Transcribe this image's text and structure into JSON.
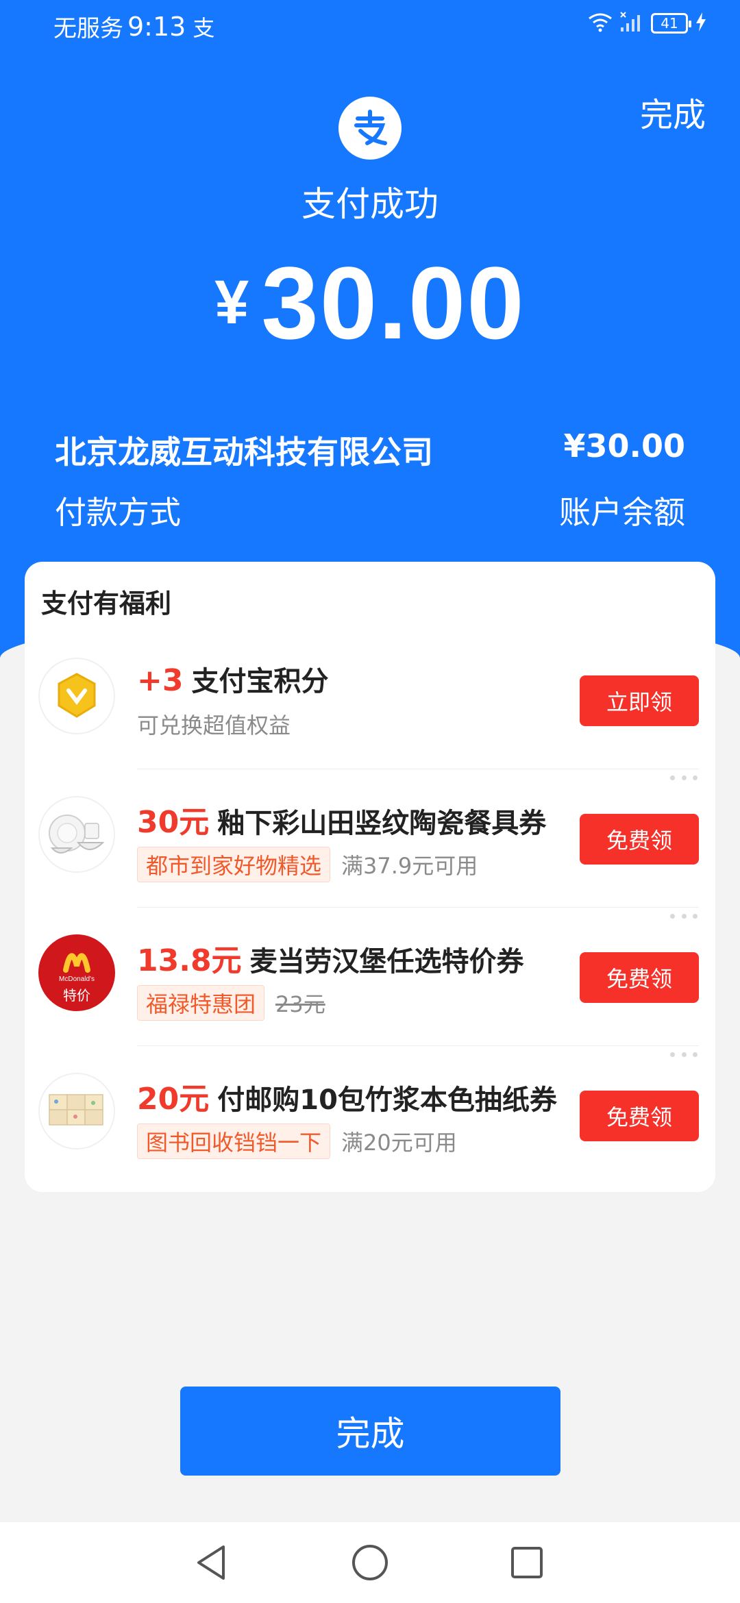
{
  "status_bar": {
    "carrier": "无服务",
    "time": "9:13",
    "alipay_glyph": "支",
    "battery": "41"
  },
  "header": {
    "done_label": "完成",
    "success_text": "支付成功",
    "currency_symbol": "¥",
    "amount": "30.00"
  },
  "details": {
    "merchant": "北京龙威互动科技有限公司",
    "merchant_amount": "¥30.00",
    "payment_method_label": "付款方式",
    "payment_method_value": "账户余额"
  },
  "benefits": {
    "title": "支付有福利",
    "items": [
      {
        "highlight": "+3",
        "title": "支付宝积分",
        "subtitle": "可兑换超值权益",
        "tag": "",
        "note": "",
        "button": "立即领",
        "thumb_icon": "points-medal-icon"
      },
      {
        "highlight": "30元",
        "title": "釉下彩山田竖纹陶瓷餐具券",
        "subtitle": "",
        "tag": "都市到家好物精选",
        "note": "满37.9元可用",
        "button": "免费领",
        "thumb_icon": "tableware-thumbnail"
      },
      {
        "highlight": "13.8元",
        "title": "麦当劳汉堡任选特价券",
        "subtitle": "",
        "tag": "福禄特惠团",
        "note": "23元",
        "button": "免费领",
        "thumb_icon": "mcdonalds-logo",
        "thumb_text": "特价",
        "thumb_brand": "McDonald's"
      },
      {
        "highlight": "20元",
        "title": "付邮购10包竹浆本色抽纸券",
        "subtitle": "",
        "tag": "图书回收铛铛一下",
        "note": "满20元可用",
        "button": "免费领",
        "thumb_icon": "tissue-pack-thumbnail"
      }
    ]
  },
  "footer": {
    "done_label": "完成"
  },
  "colors": {
    "brand_blue": "#1677ff",
    "button_red": "#f5312a",
    "highlight_red": "#f03a2c"
  }
}
